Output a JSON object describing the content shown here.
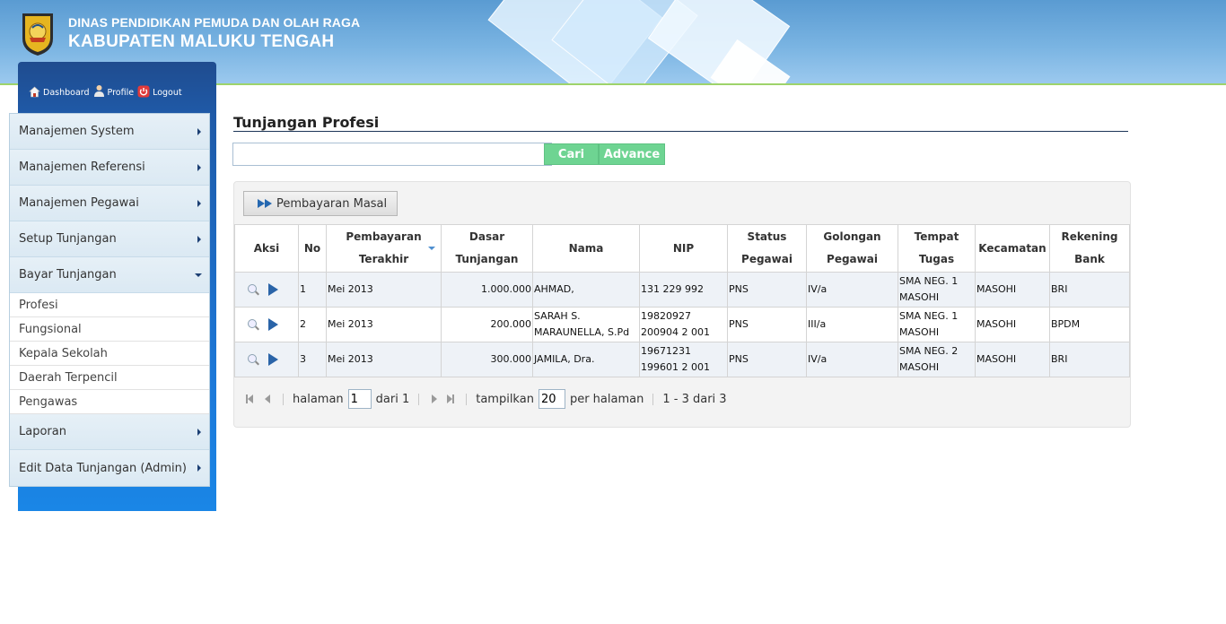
{
  "header": {
    "line1": "DINAS PENDIDIKAN PEMUDA DAN OLAH RAGA",
    "line2": "KABUPATEN MALUKU TENGAH"
  },
  "topnav": {
    "dashboard": "Dashboard",
    "profile": "Profile",
    "logout": "Logout"
  },
  "menu": {
    "items": [
      {
        "label": "Manajemen System"
      },
      {
        "label": "Manajemen Referensi"
      },
      {
        "label": "Manajemen Pegawai"
      },
      {
        "label": "Setup Tunjangan"
      },
      {
        "label": "Bayar Tunjangan"
      }
    ],
    "subitems": [
      {
        "label": "Profesi"
      },
      {
        "label": "Fungsional"
      },
      {
        "label": "Kepala Sekolah"
      },
      {
        "label": "Daerah Terpencil"
      },
      {
        "label": "Pengawas"
      }
    ],
    "after": [
      {
        "label": "Laporan"
      },
      {
        "label": "Edit Data Tunjangan (Admin)"
      }
    ]
  },
  "page": {
    "title": "Tunjangan Profesi",
    "search_value": "",
    "search_button": "Cari",
    "advance_button": "Advance",
    "masal_button": "Pembayaran Masal"
  },
  "table": {
    "headers": [
      {
        "l1": "Aksi",
        "l2": ""
      },
      {
        "l1": "No",
        "l2": ""
      },
      {
        "l1": "Pembayaran",
        "l2": "Terakhir"
      },
      {
        "l1": "Dasar",
        "l2": "Tunjangan"
      },
      {
        "l1": "Nama",
        "l2": ""
      },
      {
        "l1": "NIP",
        "l2": ""
      },
      {
        "l1": "Status",
        "l2": "Pegawai"
      },
      {
        "l1": "Golongan",
        "l2": "Pegawai"
      },
      {
        "l1": "Tempat",
        "l2": "Tugas"
      },
      {
        "l1": "Kecamatan",
        "l2": ""
      },
      {
        "l1": "Rekening",
        "l2": "Bank"
      }
    ],
    "rows": [
      {
        "no": "1",
        "terakhir": "Mei 2013",
        "dasar": "1.000.000",
        "nama_1": "AHMAD,",
        "nama_2": "",
        "nip_1": "131 229 992",
        "nip_2": "",
        "status": "PNS",
        "golongan": "IV/a",
        "tempat_1": "SMA NEG. 1",
        "tempat_2": "MASOHI",
        "kecamatan": "MASOHI",
        "bank": "BRI"
      },
      {
        "no": "2",
        "terakhir": "Mei 2013",
        "dasar": "200.000",
        "nama_1": "SARAH S.",
        "nama_2": "MARAUNELLA, S.Pd",
        "nip_1": "19820927",
        "nip_2": "200904 2 001",
        "status": "PNS",
        "golongan": "III/a",
        "tempat_1": "SMA NEG. 1",
        "tempat_2": "MASOHI",
        "kecamatan": "MASOHI",
        "bank": "BPDM"
      },
      {
        "no": "3",
        "terakhir": "Mei 2013",
        "dasar": "300.000",
        "nama_1": "JAMILA, Dra.",
        "nama_2": "",
        "nip_1": "19671231",
        "nip_2": "199601 2 001",
        "status": "PNS",
        "golongan": "IV/a",
        "tempat_1": "SMA NEG. 2",
        "tempat_2": "MASOHI",
        "kecamatan": "MASOHI",
        "bank": "BRI"
      }
    ]
  },
  "pager": {
    "halaman_label": "halaman",
    "page_value": "1",
    "dari_label": "dari 1",
    "tampilkan_label": "tampilkan",
    "per_page_value": "20",
    "per_halaman_label": "per halaman",
    "summary": "1 - 3 dari 3"
  }
}
